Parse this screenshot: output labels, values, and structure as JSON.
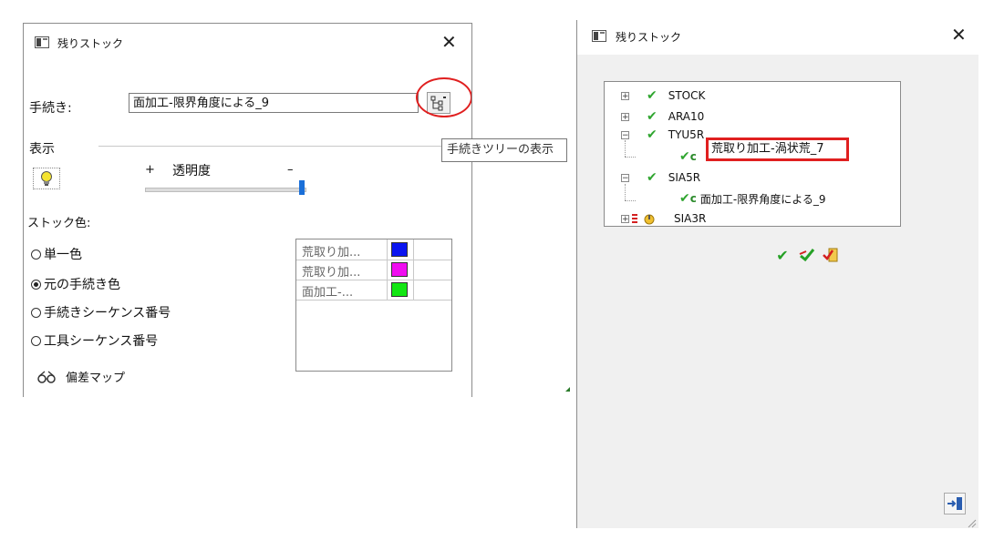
{
  "left_dialog": {
    "title": "残りストック",
    "close_glyph": "✕",
    "procedure_label": "手続き:",
    "procedure_value": "面加工-限界角度による_9",
    "display_label": "表示",
    "transparency_plus": "+",
    "transparency_label": "透明度",
    "transparency_minus": "–",
    "transparency_level_percent": 100,
    "stock_color_label": "ストック色:",
    "radio_options": [
      {
        "label": "単一色",
        "checked": false
      },
      {
        "label": "元の手続き色",
        "checked": true
      },
      {
        "label": "手続きシーケンス番号",
        "checked": false
      },
      {
        "label": "工具シーケンス番号",
        "checked": false
      }
    ],
    "color_rows": [
      {
        "name": "荒取り加...",
        "color": "#0a14f0"
      },
      {
        "name": "荒取り加...",
        "color": "#f00cf0"
      },
      {
        "name": "面加工-...",
        "color": "#12e612"
      }
    ],
    "deviation_map_label": "偏差マップ",
    "tooltip": "手続きツリーの表示",
    "accent_red": "#e02020"
  },
  "right_dialog": {
    "title": "残りストック",
    "close_glyph": "✕",
    "tree": [
      {
        "label": "STOCK",
        "expander": "+"
      },
      {
        "label": "ARA10",
        "expander": "+"
      },
      {
        "label": "TYU5R",
        "expander": "−"
      },
      {
        "label": "荒取り加工-渦状荒_7",
        "child": true
      },
      {
        "label": "SIA5R",
        "expander": "−"
      },
      {
        "label": "面加工-限界角度による_9",
        "child": true
      },
      {
        "label": "SIA3R",
        "expander": "+"
      }
    ],
    "c_mark": "c",
    "check_glyph": "✔"
  }
}
